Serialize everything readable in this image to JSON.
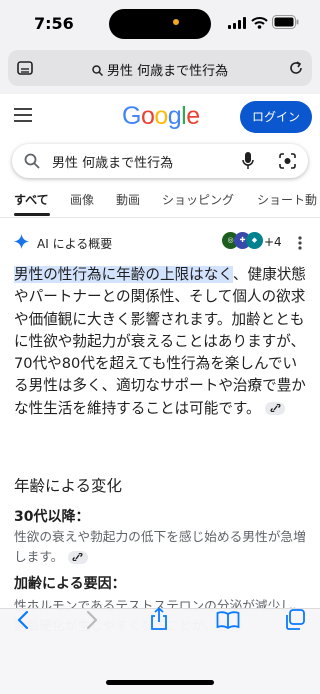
{
  "status": {
    "time": "7:56"
  },
  "browser": {
    "url_text": "男性 何歳まで性行為",
    "icons": [
      "tabs-icon",
      "search-icon",
      "reload-icon"
    ]
  },
  "google": {
    "logo": [
      "G",
      "o",
      "o",
      "g",
      "l",
      "e"
    ],
    "logo_colors": [
      "#4285f4",
      "#ea4335",
      "#fbbc05",
      "#4285f4",
      "#34a853",
      "#ea4335"
    ],
    "login_label": "ログイン",
    "search_query": "男性 何歳まで性行為"
  },
  "tabs": [
    "すべて",
    "画像",
    "動画",
    "ショッピング",
    "ショート動"
  ],
  "ai_overview": {
    "label": "AI による概要",
    "sources_more": "+4",
    "highlight": "男性の性行為に年齢の上限はなく",
    "body": "、健康状態やパートナーとの関係性、そして個人の欲求や価値観に大きく影響されます。加齢とともに性欲や勃起力が衰えることはありますが、70代や80代を超えても性行為を楽しんでいる男性は多く、適切なサポートや治療で豊かな性生活を維持することは可能です。",
    "section_title": "年齢による変化",
    "sections": [
      {
        "title": "30代以降：",
        "text": "性欲の衰えや勃起力の低下を感じ始める男性が急増します。"
      },
      {
        "title": "加齢による要因：",
        "text": "性ホルモンであるテストステロンの分泌が減少し、動脈硬化が生じやすくなることが、性"
      }
    ]
  },
  "bottom_bar": [
    "back-icon",
    "forward-icon",
    "share-icon",
    "bookmarks-icon",
    "tabs-overview-icon"
  ]
}
